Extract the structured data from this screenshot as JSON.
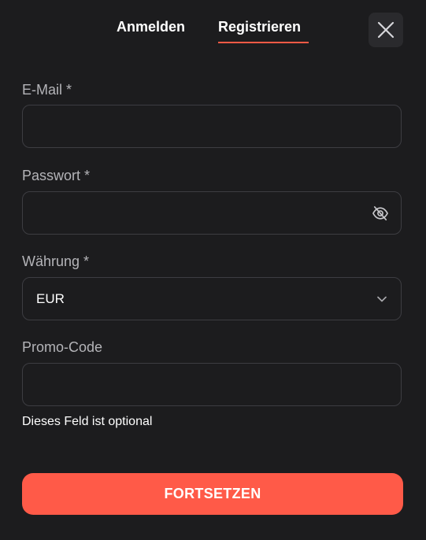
{
  "tabs": {
    "login_label": "Anmelden",
    "register_label": "Registrieren",
    "active": "register"
  },
  "close": {
    "icon": "close-icon"
  },
  "form": {
    "email": {
      "label": "E-Mail *",
      "value": "",
      "placeholder": ""
    },
    "password": {
      "label": "Passwort *",
      "value": "",
      "placeholder": "",
      "toggle_icon": "eye-off-icon"
    },
    "currency": {
      "label": "Währung *",
      "selected": "EUR",
      "icon": "chevron-down-icon"
    },
    "promo": {
      "label": "Promo-Code",
      "value": "",
      "placeholder": "",
      "hint": "Dieses Feld ist optional"
    },
    "submit_label": "FORTSETZEN"
  },
  "colors": {
    "background": "#1c1c1e",
    "accent": "#ff5a45",
    "field_border": "#3d3d42",
    "label": "#b4b4b8"
  }
}
